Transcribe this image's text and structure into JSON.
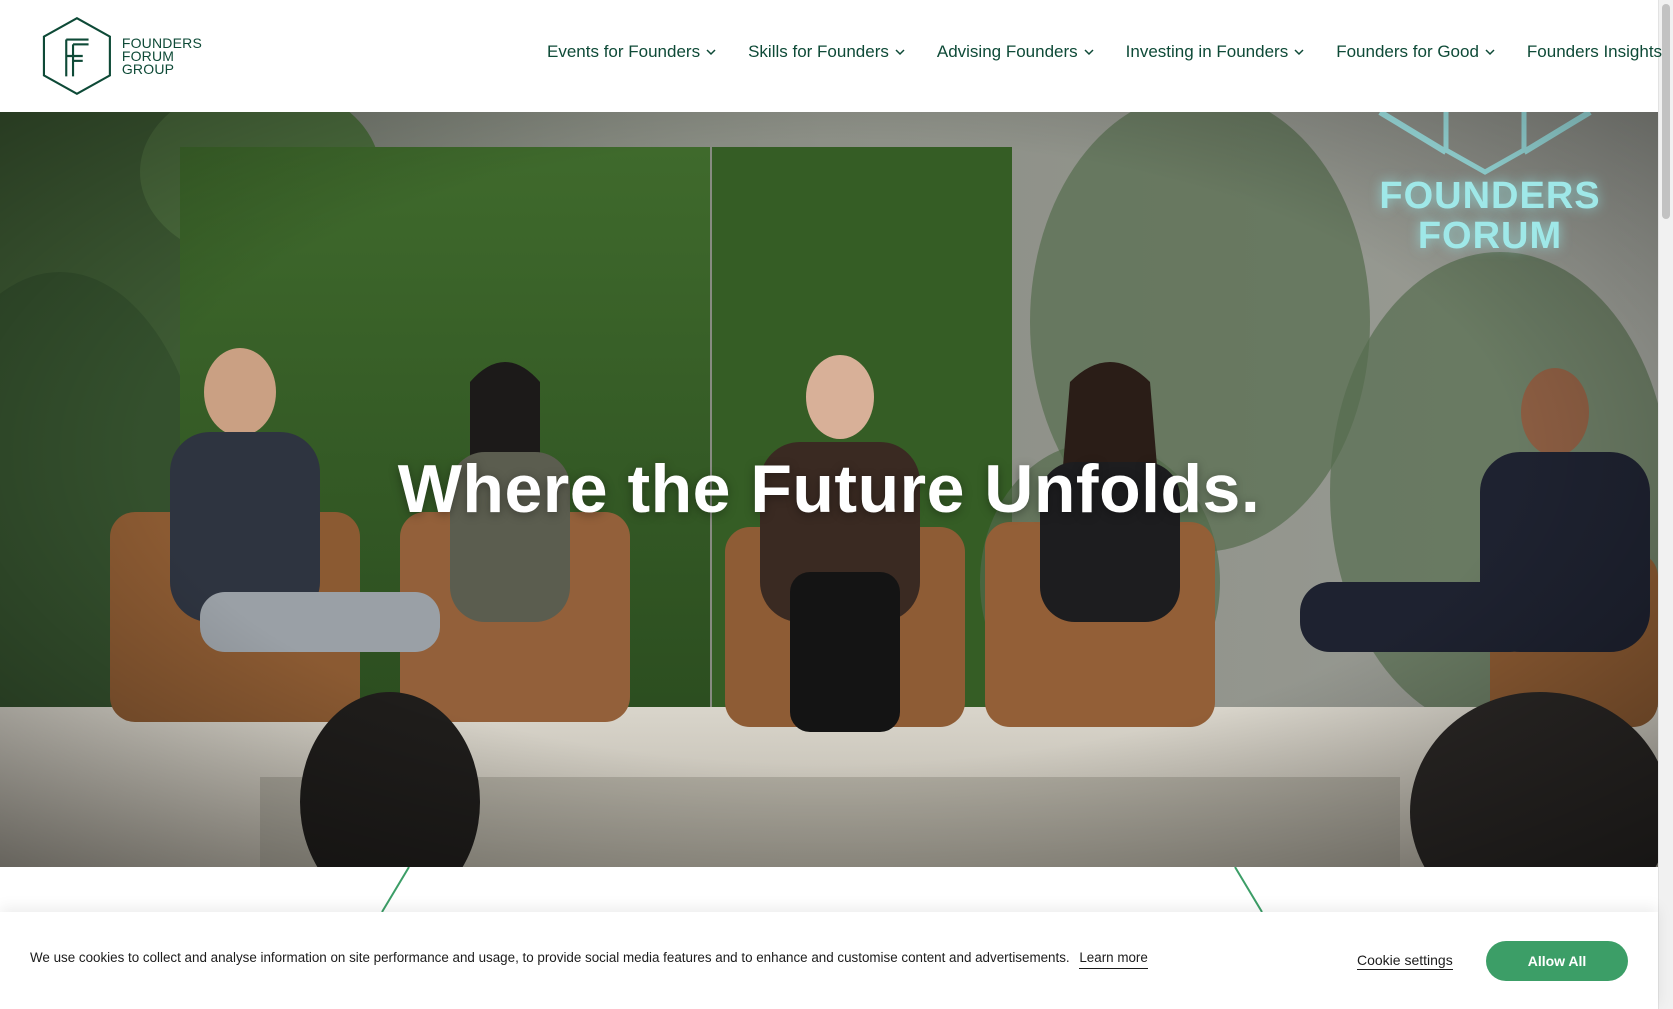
{
  "logo": {
    "line1": "FOUNDERS",
    "line2": "FORUM",
    "line3": "GROUP",
    "icon": "founders-forum-hexagon-logo"
  },
  "nav": {
    "items": [
      {
        "label": "Events for Founders",
        "has_dropdown": true
      },
      {
        "label": "Skills for Founders",
        "has_dropdown": true
      },
      {
        "label": "Advising Founders",
        "has_dropdown": true
      },
      {
        "label": "Investing in Founders",
        "has_dropdown": true
      },
      {
        "label": "Founders for Good",
        "has_dropdown": true
      },
      {
        "label": "Founders Insights",
        "has_dropdown": false
      }
    ]
  },
  "hero": {
    "title": "Where the Future Unfolds.",
    "stage_sign_line1": "FOUNDERS",
    "stage_sign_line2": "FORUM"
  },
  "cookie_bar": {
    "message": "We use cookies to collect and analyse information on site performance and usage, to provide social media features and to enhance and customise content and advertisements.",
    "learn_more": "Learn more",
    "settings": "Cookie settings",
    "allow_all": "Allow All"
  },
  "colors": {
    "brand_dark_green": "#0e4a37",
    "accent_green": "#3c9e67",
    "line_green": "#3c9e67"
  }
}
